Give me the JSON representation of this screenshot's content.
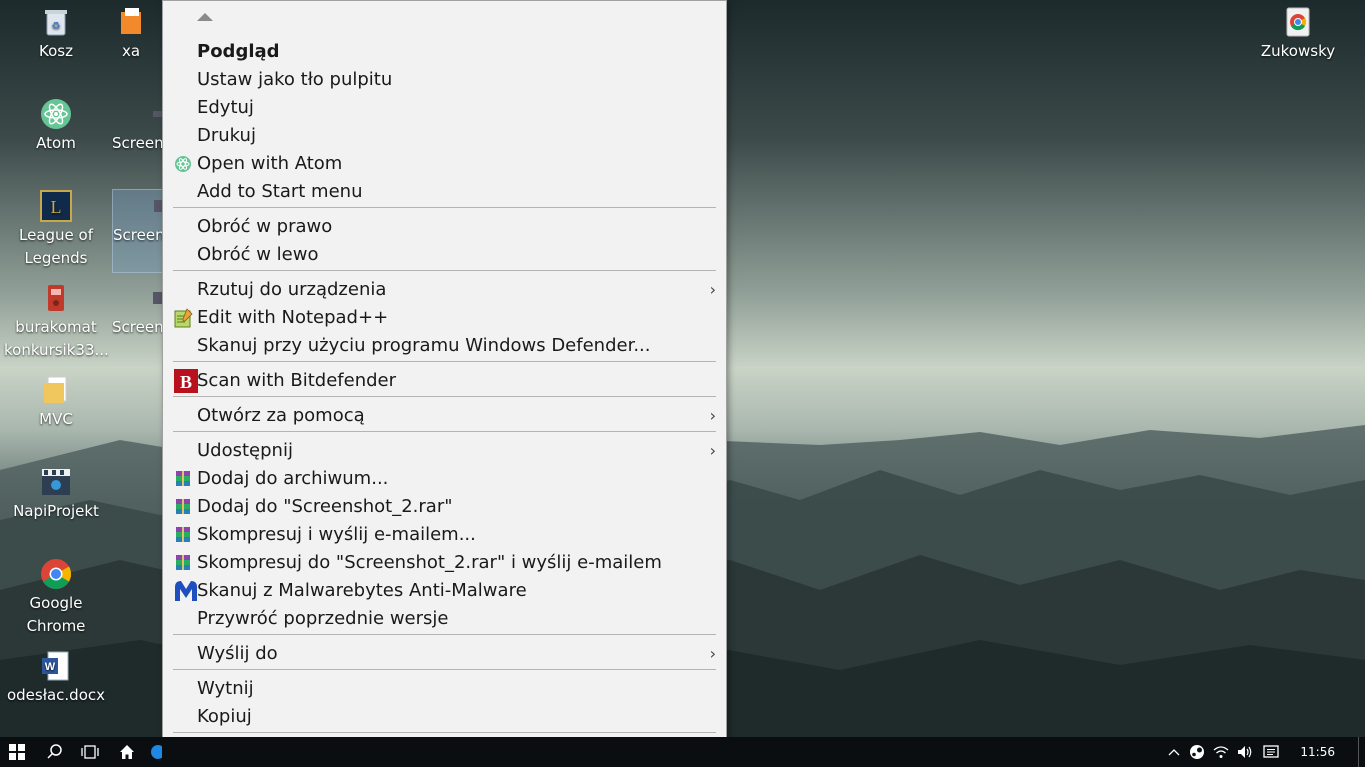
{
  "desktop": {
    "icons": [
      {
        "label": "Kosz"
      },
      {
        "label": "xa"
      },
      {
        "label": "Atom"
      },
      {
        "label": "Screen"
      },
      {
        "label": "League of Legends"
      },
      {
        "label": "Screen"
      },
      {
        "label": "burakomat konkursik33..."
      },
      {
        "label": "Screen"
      },
      {
        "label": "MVC"
      },
      {
        "label": "NapiProjekt"
      },
      {
        "label": "Google Chrome"
      },
      {
        "label": "odesłac.docx"
      },
      {
        "label": "Zukowsky"
      }
    ]
  },
  "context_menu": {
    "items": [
      {
        "label": "Podgląd"
      },
      {
        "label": "Ustaw jako tło pulpitu"
      },
      {
        "label": "Edytuj"
      },
      {
        "label": "Drukuj"
      },
      {
        "label": "Open with Atom",
        "icon": "atom-icon"
      },
      {
        "label": "Add to Start menu"
      },
      {
        "label": "Obróć w prawo"
      },
      {
        "label": "Obróć w lewo"
      },
      {
        "label": "Rzutuj do urządzenia"
      },
      {
        "label": "Edit with Notepad++",
        "icon": "notepad-plus-plus-icon"
      },
      {
        "label": "Skanuj przy użyciu programu Windows Defender..."
      },
      {
        "label": "Scan with Bitdefender",
        "icon": "bitdefender-icon"
      },
      {
        "label": "Otwórz za pomocą"
      },
      {
        "label": "Udostępnij"
      },
      {
        "label": "Dodaj do archiwum...",
        "icon": "winrar-icon"
      },
      {
        "label": "Dodaj do \"Screenshot_2.rar\"",
        "icon": "winrar-icon"
      },
      {
        "label": "Skompresuj i wyślij e-mailem...",
        "icon": "winrar-icon"
      },
      {
        "label": "Skompresuj do \"Screenshot_2.rar\" i wyślij e-mailem",
        "icon": "winrar-icon"
      },
      {
        "label": "Skanuj z Malwarebytes Anti-Malware",
        "icon": "malwarebytes-icon"
      },
      {
        "label": "Przywróć poprzednie wersje"
      },
      {
        "label": "Wyślij do"
      },
      {
        "label": "Wytnij"
      },
      {
        "label": "Kopiuj"
      }
    ],
    "submenu_glyph": "›"
  },
  "taskbar": {
    "clock": "11:56"
  },
  "colors": {
    "menu_bg": "#f2f2f2",
    "taskbar_bg": "#0b0e10",
    "atom_green": "#66c595",
    "bitdefender_red": "#b8101d",
    "malwarebytes_blue": "#1f4fbf"
  }
}
